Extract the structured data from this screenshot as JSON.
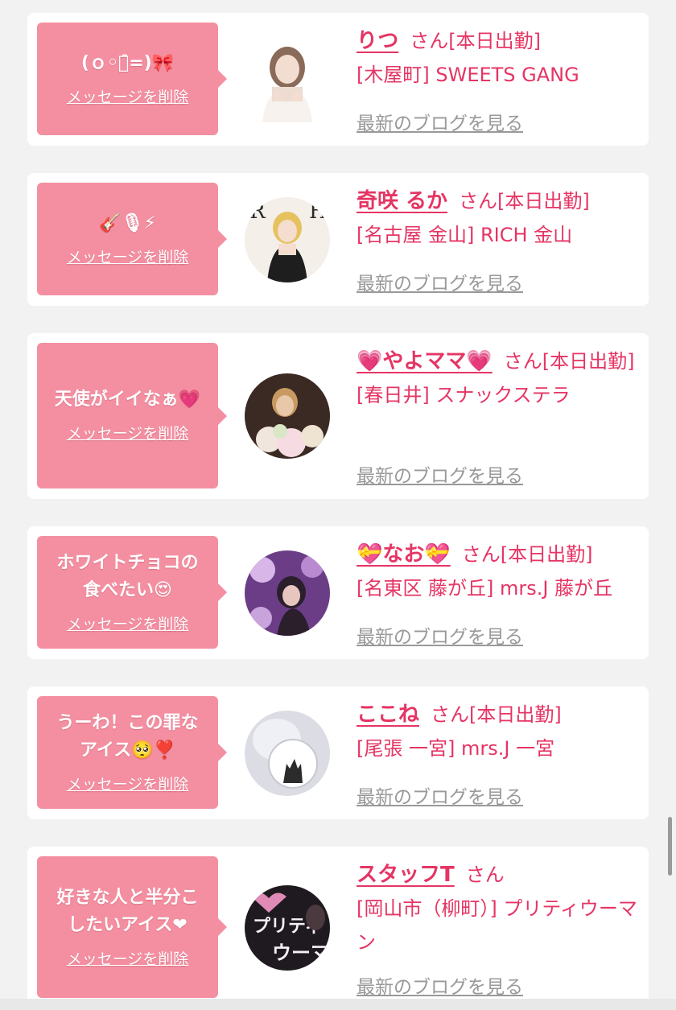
{
  "colors": {
    "accent": "#e53564",
    "bubble": "#f48fa1",
    "muted": "#999999",
    "background": "#f2f2f2"
  },
  "cards": [
    {
      "message": "(ｏ◦ｏ̑=)🎀",
      "delete_label": "メッセージを削除",
      "name": "りつ",
      "suffix": "さん[本日出勤]",
      "shop": "[木屋町] SWEETS GANG",
      "blog_label": "最新のブログを見る"
    },
    {
      "message": "🎸🎙⚡",
      "delete_label": "メッセージを削除",
      "name": "奇咲 るか",
      "suffix": "さん[本日出勤]",
      "shop": "[名古屋 金山] RICH 金山",
      "blog_label": "最新のブログを見る"
    },
    {
      "message": "天使がイイなぁ💗",
      "delete_label": "メッセージを削除",
      "name": "💗やよママ💗",
      "suffix": "さん[本日出勤]",
      "shop": "[春日井] スナックステラ",
      "blog_label": "最新のブログを見る"
    },
    {
      "message": "ホワイトチョコの\n食べたい😍",
      "delete_label": "メッセージを削除",
      "name": "💝なお💝",
      "suffix": "さん[本日出勤]",
      "shop": "[名東区 藤が丘] mrs.J 藤が丘",
      "blog_label": "最新のブログを見る"
    },
    {
      "message": "うーわ！この罪な\nアイス🥺❣️",
      "delete_label": "メッセージを削除",
      "name": "ここね",
      "suffix": "さん[本日出勤]",
      "shop": "[尾張 一宮] mrs.J 一宮",
      "blog_label": "最新のブログを見る"
    },
    {
      "message": "好きな人と半分こ\nしたいアイス❤",
      "delete_label": "メッセージを削除",
      "name": "スタッフT",
      "suffix": "さん",
      "shop": "[岡山市（柳町）] プリティウーマン",
      "blog_label": "最新のブログを見る"
    }
  ],
  "avatar_thumbs": [
    {
      "icon": "girl-portrait-icon",
      "palette": [
        "#ffffff",
        "#d9c7b8",
        "#7a5a48"
      ]
    },
    {
      "icon": "magazine-cover-icon",
      "palette": [
        "#f4efe9",
        "#e6c25f",
        "#1e1e1e"
      ]
    },
    {
      "icon": "woman-with-flowers-icon",
      "palette": [
        "#3b2a24",
        "#e8c8a8",
        "#f1e6de"
      ]
    },
    {
      "icon": "purple-flowers-icon",
      "palette": [
        "#6b3d86",
        "#d8b7e8",
        "#2a1f2b"
      ]
    },
    {
      "icon": "face-with-cat-sticker-icon",
      "palette": [
        "#dcdde4",
        "#ffffff",
        "#2b2b2b"
      ]
    },
    {
      "icon": "pretty-woman-logo-icon",
      "palette": [
        "#1f1a1f",
        "#e08ab7",
        "#f5f0f5"
      ]
    }
  ]
}
